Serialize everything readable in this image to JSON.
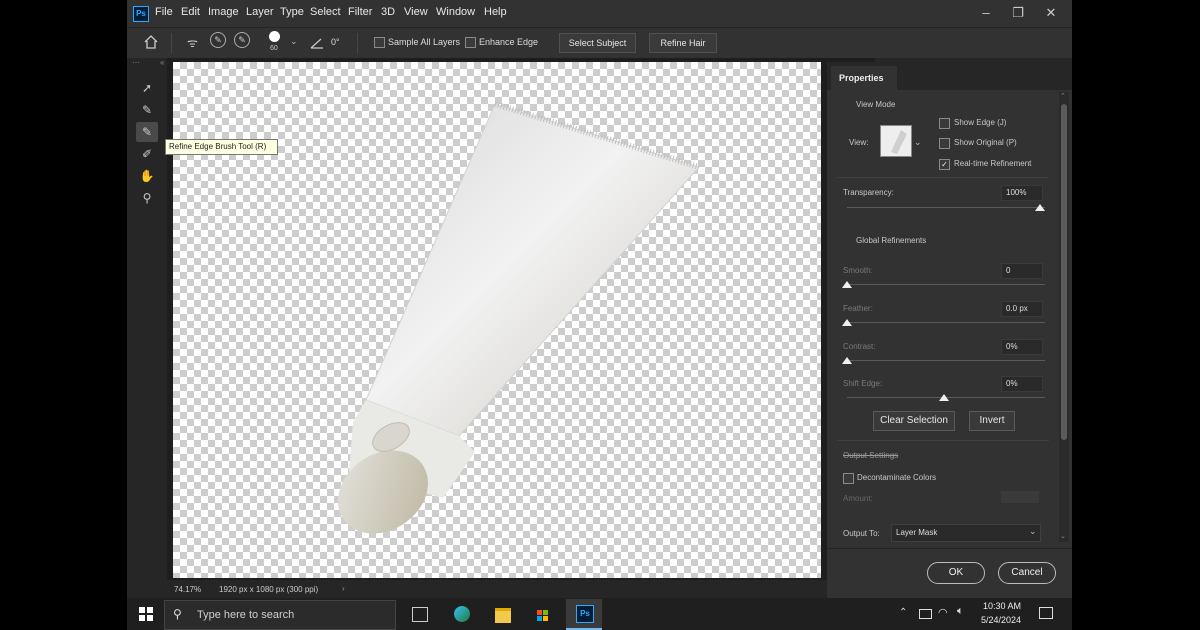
{
  "app": {
    "logo": "Ps"
  },
  "menu": [
    "File",
    "Edit",
    "Image",
    "Layer",
    "Type",
    "Select",
    "Filter",
    "3D",
    "View",
    "Window",
    "Help"
  ],
  "window_controls": {
    "minimize": "–",
    "restore": "❐",
    "close": "✕"
  },
  "options_bar": {
    "brush_size": "60",
    "angle": "0°",
    "sample_all_layers": "Sample All Layers",
    "enhance_edge": "Enhance Edge",
    "select_subject": "Select Subject",
    "refine_hair": "Refine Hair"
  },
  "tools": [
    {
      "icon": "quick-selection-icon",
      "glyph": "➚"
    },
    {
      "icon": "brush-icon",
      "glyph": "✎"
    },
    {
      "icon": "refine-edge-brush-icon",
      "glyph": "✎"
    },
    {
      "icon": "lasso-brush-icon",
      "glyph": "✐"
    },
    {
      "icon": "hand-icon",
      "glyph": "✋"
    },
    {
      "icon": "zoom-icon",
      "glyph": "⚲"
    }
  ],
  "tooltip": "Refine Edge Brush Tool (R)",
  "status": {
    "zoom": "74.17%",
    "doc": "1920 px x 1080 px (300 ppi)",
    "arrow": "›"
  },
  "properties": {
    "tab": "Properties",
    "view_mode": {
      "title": "View Mode",
      "view_label": "View:",
      "show_edge": "Show Edge (J)",
      "show_original": "Show Original (P)",
      "realtime": "Real-time Refinement",
      "realtime_checked": true
    },
    "transparency": {
      "label": "Transparency:",
      "value": "100%",
      "level": 1.0
    },
    "global_title": "Global Refinements",
    "smooth": {
      "label": "Smooth:",
      "value": "0",
      "level": 0
    },
    "feather": {
      "label": "Feather:",
      "value": "0.0 px",
      "level": 0
    },
    "contrast": {
      "label": "Contrast:",
      "value": "0%",
      "level": 0
    },
    "shift_edge": {
      "label": "Shift Edge:",
      "value": "0%",
      "level": 0.5
    },
    "clear_selection": "Clear Selection",
    "invert": "Invert",
    "output_settings": "Output Settings",
    "decontaminate": "Decontaminate Colors",
    "amount": "Amount:",
    "output_to_label": "Output To:",
    "output_to_value": "Layer Mask",
    "ok": "OK",
    "cancel": "Cancel"
  },
  "taskbar": {
    "search_placeholder": "Type here to search",
    "time": "10:30 AM",
    "date": "5/24/2024",
    "ps_icon": "Ps"
  },
  "colors": {
    "accent": "#31a8ff",
    "panel": "#323232",
    "canvas_bg": "#1e1e1e"
  }
}
